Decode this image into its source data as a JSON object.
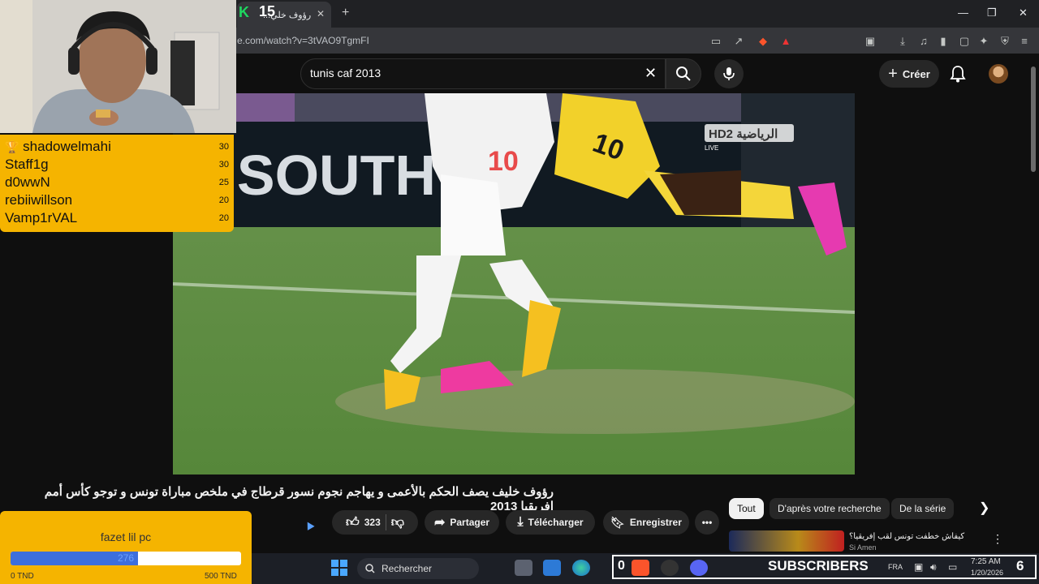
{
  "browser": {
    "tab_title": "رؤوف خلي...",
    "tab_badge": "15",
    "url": "e.com/watch?v=3tVAO9TgmFI"
  },
  "youtube": {
    "search_query": "tunis caf 2013",
    "create_label": "Créer",
    "video_title": "رؤوف خليف يصف الحكم بالأعمى و يهاجم نجوم نسور قرطاج في ملخص مباراة تونس و توجو كأس أمم افريقيا 2013",
    "like_count": "323",
    "share_label": "Partager",
    "download_label": "Télécharger",
    "save_label": "Enregistrer",
    "more_label": "•••",
    "chips": [
      "Tout",
      "D'après votre recherche",
      "De la série"
    ],
    "recommended": {
      "title": "كيفاش خطفت تونس لقب إفريقيا؟",
      "channel": "Si Amen"
    },
    "video_overlay": {
      "channel_logo": "HD2 الرياضية",
      "live_label": "LIVE",
      "banner_text": ", SOUTH A"
    }
  },
  "stream_overlay": {
    "leaderboard": [
      {
        "name": "shadowelmahi",
        "score": "30",
        "trophy": true
      },
      {
        "name": "Staff1g",
        "score": "30"
      },
      {
        "name": "d0wwN",
        "score": "25"
      },
      {
        "name": "rebiiwillson",
        "score": "20"
      },
      {
        "name": "Vamp1rVAL",
        "score": "20"
      }
    ],
    "goal": {
      "name": "fazet lil pc",
      "current": "276",
      "min_label": "0 TND",
      "max_label": "500 TND",
      "progress": 0.552
    },
    "subscribers": {
      "count": "0",
      "label": "SUBSCRIBERS",
      "number": "6"
    }
  },
  "taskbar": {
    "search_placeholder": "Rechercher",
    "language": "FRA",
    "time": "7:25 AM",
    "date": "1/20/2026"
  },
  "colors": {
    "overlay_yellow": "#f5b400",
    "progress_blue": "#3d6fdc",
    "youtube_bg": "#0f0f0f"
  }
}
